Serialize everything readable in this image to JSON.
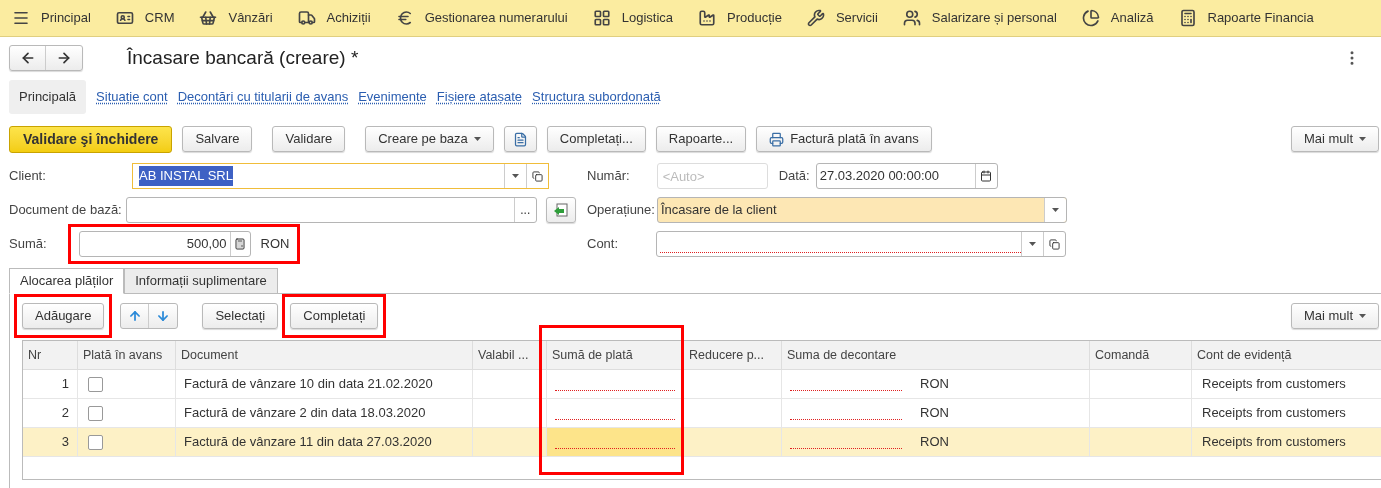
{
  "menu": [
    {
      "label": "Principal"
    },
    {
      "label": "CRM"
    },
    {
      "label": "Vânzări"
    },
    {
      "label": "Achiziții"
    },
    {
      "label": "Gestionarea numerarului"
    },
    {
      "label": "Logistica"
    },
    {
      "label": "Producție"
    },
    {
      "label": "Servicii"
    },
    {
      "label": "Salarizare și personal"
    },
    {
      "label": "Analiză"
    },
    {
      "label": "Rapoarte Financia"
    }
  ],
  "title": "Încasare bancară (creare) *",
  "sections": [
    {
      "label": "Principală",
      "selected": true
    },
    {
      "label": "Situație cont",
      "selected": false
    },
    {
      "label": "Decontări cu titularii de avans",
      "selected": false
    },
    {
      "label": "Evenimente",
      "selected": false
    },
    {
      "label": "Fișiere atașate",
      "selected": false
    },
    {
      "label": "Structura subordonată",
      "selected": false
    }
  ],
  "toolbar": {
    "primary": "Validare şi închidere",
    "buttons": [
      {
        "kind": "plain",
        "label": "Salvare"
      },
      {
        "kind": "plain",
        "label": "Validare"
      },
      {
        "kind": "dropdown",
        "label": "Creare pe baza"
      },
      {
        "kind": "document"
      },
      {
        "kind": "plain",
        "label": "Completați..."
      },
      {
        "kind": "plain",
        "label": "Rapoarte..."
      },
      {
        "kind": "print",
        "label": "Factură plată în avans"
      }
    ],
    "more": "Mai mult"
  },
  "form": {
    "client": {
      "label": "Client:",
      "value": "AB INSTAL SRL",
      "text_selected": true
    },
    "base_document": {
      "label": "Document de bază:",
      "button": "..."
    },
    "amount": {
      "label": "Sumă:",
      "value": "500,00",
      "currency": "RON",
      "highlighted": true
    },
    "number": {
      "label": "Număr:",
      "placeholder": "<Auto>"
    },
    "date": {
      "label": "Dată:",
      "value": "27.03.2020 00:00:00"
    },
    "operation": {
      "label": "Operațiune:",
      "value": "Încasare de la client"
    },
    "account": {
      "label": "Cont:",
      "required": true
    }
  },
  "tabs": [
    {
      "label": "Alocarea plăților",
      "selected": true
    },
    {
      "label": "Informații suplimentare",
      "selected": false
    }
  ],
  "table_toolbar": {
    "buttons": [
      {
        "kind": "plain",
        "label": "Adăugare",
        "highlighted": true
      },
      {
        "kind": "move"
      },
      {
        "kind": "plain",
        "label": "Selectați",
        "highlighted": false
      },
      {
        "kind": "plain",
        "label": "Completați",
        "highlighted": true
      }
    ],
    "more": "Mai mult"
  },
  "table": {
    "columns": [
      {
        "label": "Nr",
        "highlighted": false
      },
      {
        "label": "Plată în avans",
        "highlighted": false
      },
      {
        "label": "Document",
        "highlighted": false
      },
      {
        "label": "Valabil ...",
        "highlighted": false
      },
      {
        "label": "Sumă de plată",
        "highlighted": true
      },
      {
        "label": "Reducere p...",
        "highlighted": false
      },
      {
        "label": "Suma de decontare",
        "highlighted": false
      },
      {
        "label": "Comandă",
        "highlighted": false
      },
      {
        "label": "Cont de evidență",
        "highlighted": false
      }
    ],
    "rows": [
      {
        "nr": "1",
        "advance": false,
        "document": "Factură de vânzare 10 din data 21.02.2020",
        "currency": "RON",
        "account": "Receipts from customers",
        "selected": false
      },
      {
        "nr": "2",
        "advance": false,
        "document": "Factură de vânzare 2 din data 18.03.2020",
        "currency": "RON",
        "account": "Receipts from customers",
        "selected": false
      },
      {
        "nr": "3",
        "advance": false,
        "document": "Factură de vânzare 11 din data 27.03.2020",
        "currency": "RON",
        "account": "Receipts from customers",
        "selected": true
      }
    ]
  }
}
